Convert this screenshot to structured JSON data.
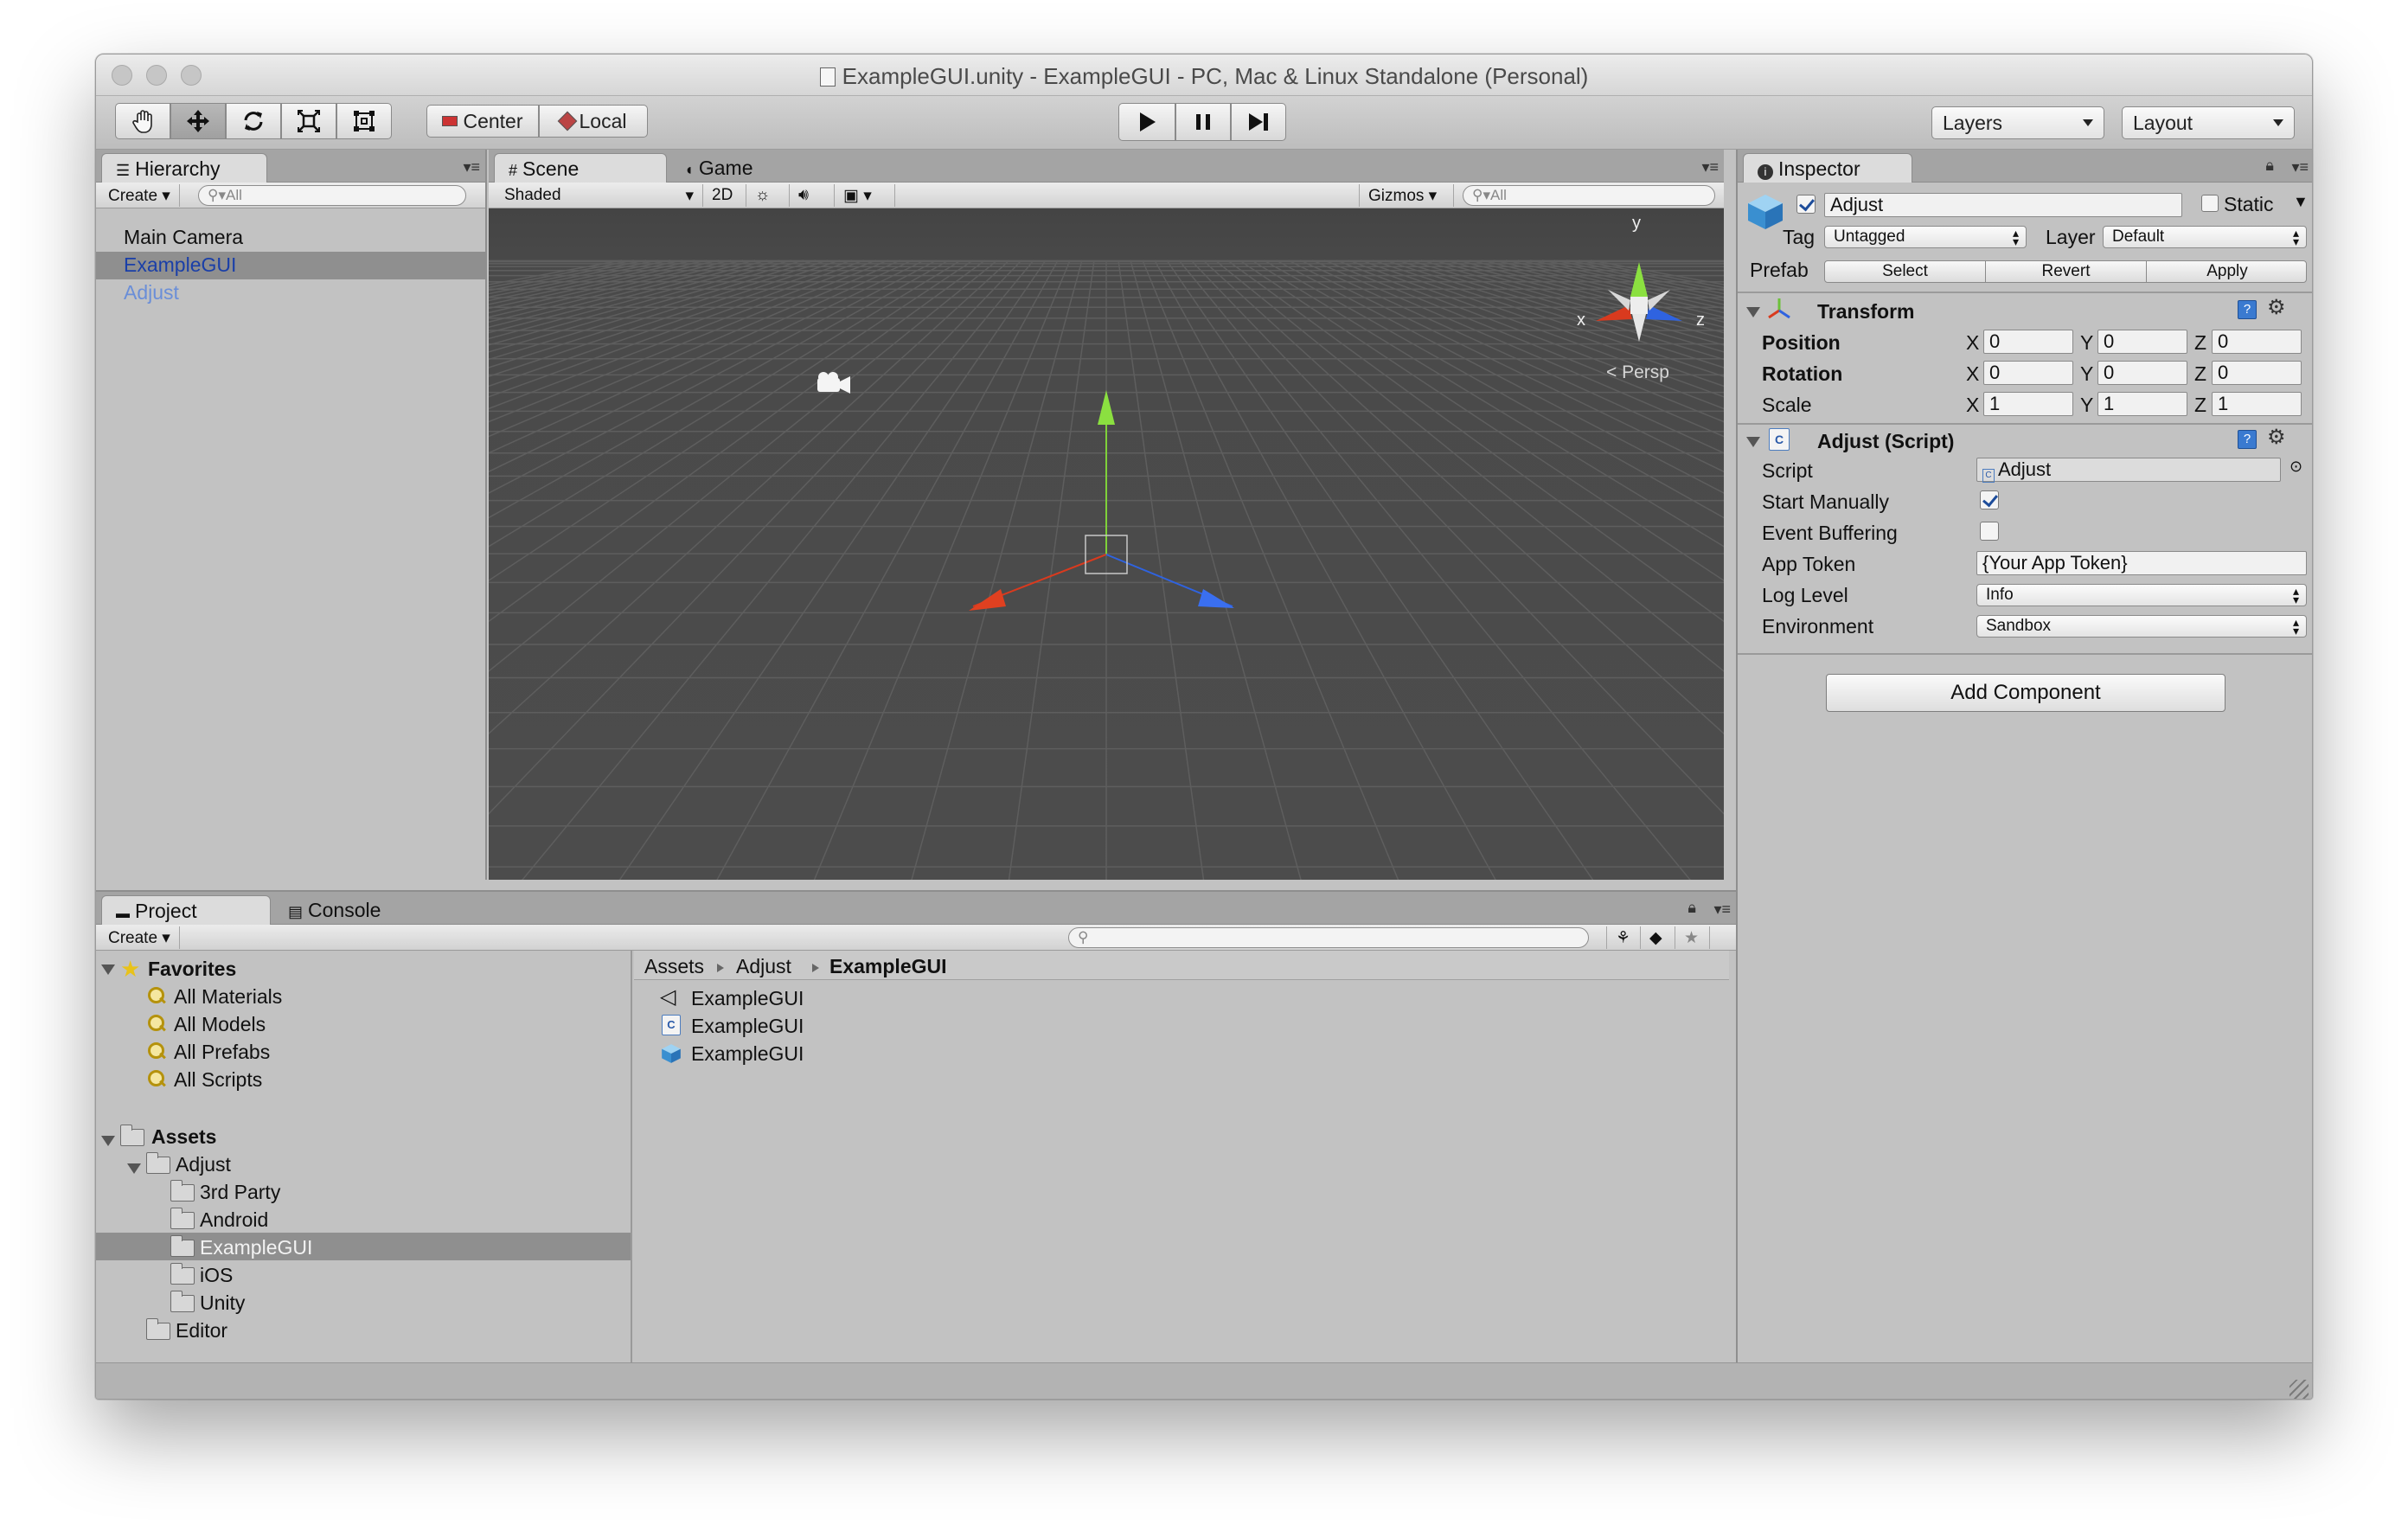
{
  "window": {
    "title": "ExampleGUI.unity - ExampleGUI - PC, Mac & Linux Standalone (Personal)"
  },
  "toolbar": {
    "center_label": "Center",
    "local_label": "Local",
    "layers_label": "Layers",
    "layout_label": "Layout",
    "tools": [
      "hand-icon",
      "move-icon",
      "rotate-icon",
      "scale-icon",
      "rect-icon"
    ]
  },
  "hierarchy": {
    "tab_label": "Hierarchy",
    "create_label": "Create",
    "search_placeholder": "All",
    "items": [
      {
        "label": "Main Camera",
        "color": "#111111"
      },
      {
        "label": "ExampleGUI",
        "color": "#1a3fa8"
      },
      {
        "label": "Adjust",
        "color": "#6a8ed8",
        "selected": true
      }
    ]
  },
  "scene": {
    "tab_scene": "Scene",
    "tab_game": "Game",
    "shading": "Shaded",
    "mode_2d": "2D",
    "gizmos_label": "Gizmos",
    "search_placeholder": "All",
    "persp_label": "Persp",
    "axis_y": "y",
    "axis_x": "x",
    "axis_z": "z"
  },
  "inspector": {
    "tab_label": "Inspector",
    "object_name": "Adjust",
    "static_label": "Static",
    "tag_label": "Tag",
    "tag_value": "Untagged",
    "layer_label": "Layer",
    "layer_value": "Default",
    "prefab_label": "Prefab",
    "prefab_select": "Select",
    "prefab_revert": "Revert",
    "prefab_apply": "Apply",
    "transform": {
      "title": "Transform",
      "rows": [
        {
          "label": "Position",
          "x": "0",
          "y": "0",
          "z": "0"
        },
        {
          "label": "Rotation",
          "x": "0",
          "y": "0",
          "z": "0"
        },
        {
          "label": "Scale",
          "x": "1",
          "y": "1",
          "z": "1"
        }
      ]
    },
    "script_component": {
      "title": "Adjust (Script)",
      "script_label": "Script",
      "script_value": "Adjust",
      "start_manually_label": "Start Manually",
      "start_manually": true,
      "event_buffering_label": "Event Buffering",
      "event_buffering": false,
      "app_token_label": "App Token",
      "app_token_value": "{Your App Token}",
      "log_level_label": "Log Level",
      "log_level_value": "Info",
      "environment_label": "Environment",
      "environment_value": "Sandbox"
    },
    "add_component_label": "Add Component"
  },
  "project": {
    "tab_project": "Project",
    "tab_console": "Console",
    "create_label": "Create",
    "favorites_label": "Favorites",
    "favorites": [
      "All Materials",
      "All Models",
      "All Prefabs",
      "All Scripts"
    ],
    "assets_label": "Assets",
    "adjust_label": "Adjust",
    "adjust_children": [
      "3rd Party",
      "Android",
      "ExampleGUI",
      "iOS",
      "Unity"
    ],
    "editor_label": "Editor",
    "breadcrumb": [
      "Assets",
      "Adjust",
      "ExampleGUI"
    ],
    "files": [
      "ExampleGUI",
      "ExampleGUI",
      "ExampleGUI"
    ]
  },
  "colors": {
    "axis_x": "#d93a1e",
    "axis_y": "#7fd13a",
    "axis_z": "#2f63e0",
    "selection": "#8f8f8f"
  }
}
